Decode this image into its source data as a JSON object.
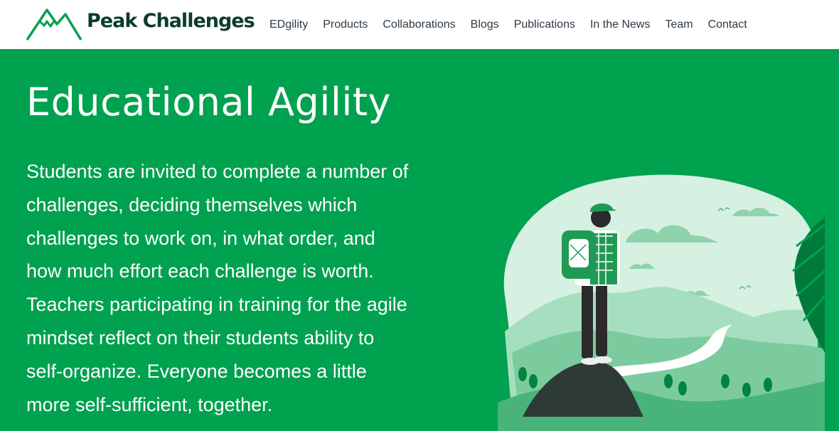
{
  "header": {
    "brand": "Peak Challenges",
    "logo_icon": "mountain-logo-icon",
    "nav": [
      {
        "label": "EDgility"
      },
      {
        "label": "Products"
      },
      {
        "label": "Collaborations"
      },
      {
        "label": "Blogs"
      },
      {
        "label": "Publications"
      },
      {
        "label": "In the News"
      },
      {
        "label": "Team"
      },
      {
        "label": "Contact"
      }
    ]
  },
  "hero": {
    "title": "Educational Agility",
    "lines": [
      "Students are invited to complete a number of",
      "challenges, deciding themselves which",
      "challenges to work on, in what order, and",
      "how much effort each challenge is worth.",
      "Teachers participating in training for the agile",
      "mindset reflect on their students ability to",
      "self-organize. Everyone becomes a little",
      "more self-sufficient, together."
    ],
    "illustration_icon": "hiker-on-mountain-illustration"
  },
  "colors": {
    "brand_green": "#00a14f",
    "dark_text": "#0b3d2a",
    "nav_text": "#2d3a45"
  }
}
